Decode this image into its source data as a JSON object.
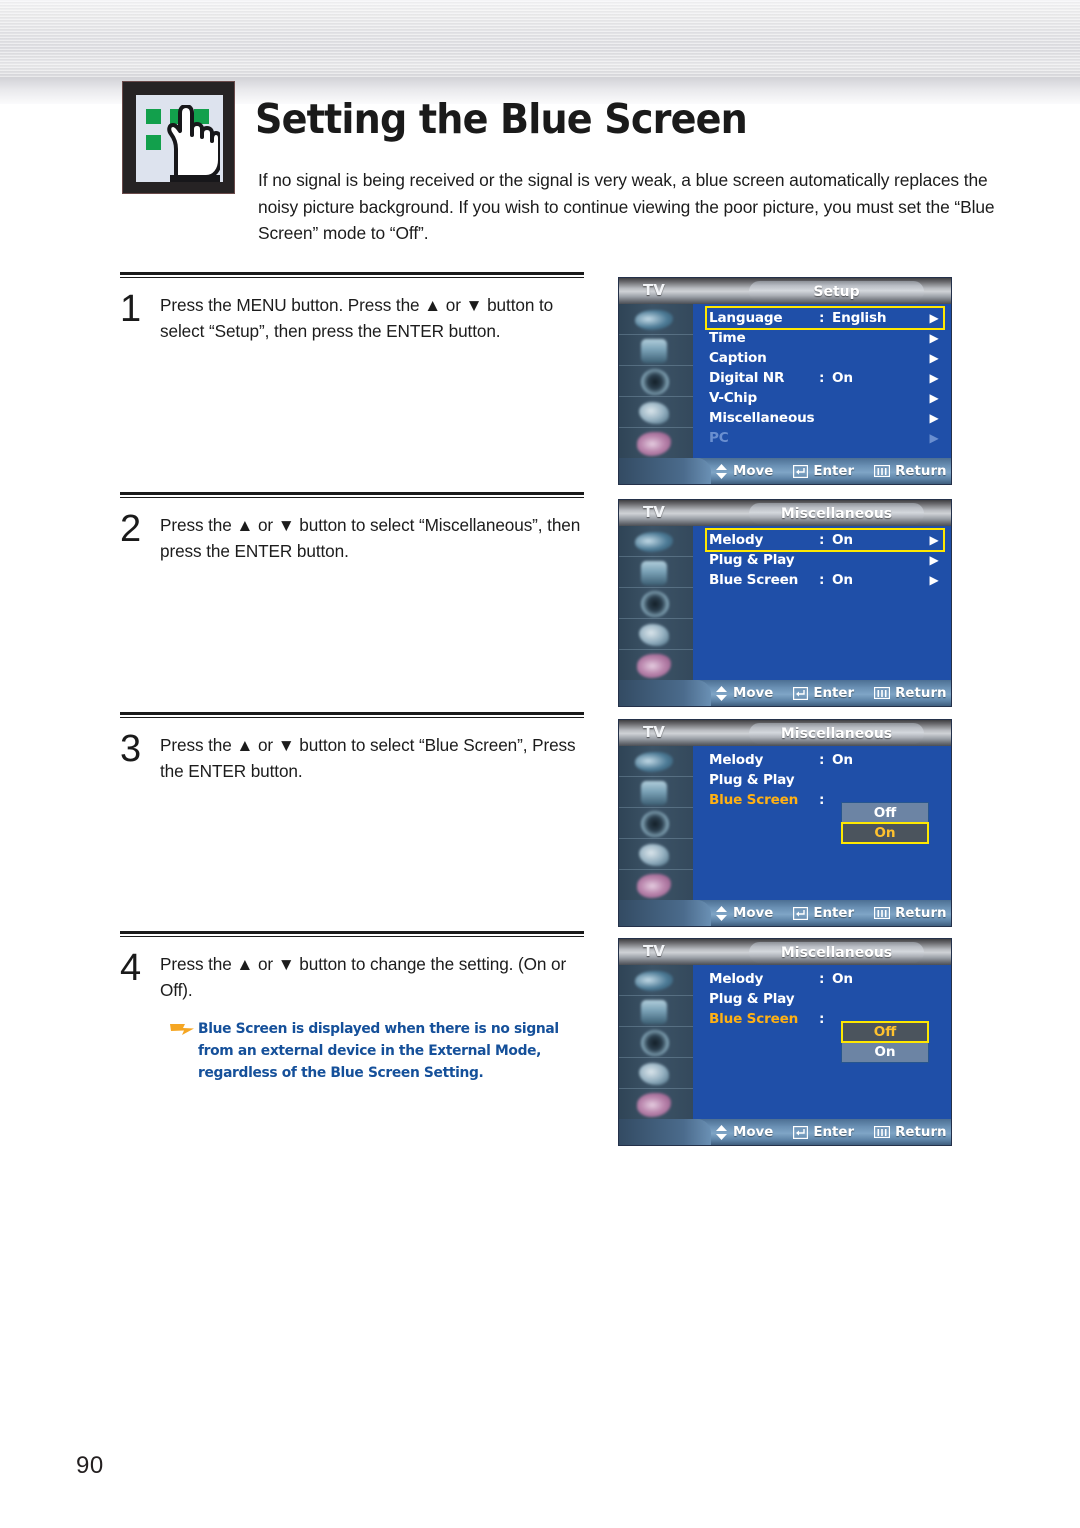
{
  "header": {
    "title": "Setting the Blue Screen",
    "icon": "hand-pointing-buttons-icon",
    "intro": "If no signal is being received or the signal is very weak, a blue screen automatically replaces the noisy picture background. If you wish to continue viewing the poor picture, you must set the “Blue Screen” mode to “Off”."
  },
  "steps": [
    {
      "number": "1",
      "text": "Press the MENU button. Press the ▲ or ▼ button to select “Setup”, then press the ENTER button."
    },
    {
      "number": "2",
      "text": "Press the ▲ or ▼ button to select “Miscellaneous”, then press the ENTER button."
    },
    {
      "number": "3",
      "text": "Press the ▲ or ▼ button to select “Blue Screen”, Press the ENTER button."
    },
    {
      "number": "4",
      "text": "Press the ▲ or ▼ button to change the setting. (On or Off)."
    }
  ],
  "note": {
    "bullet": "arrow-right-icon",
    "text": "Blue Screen is displayed when there is no signal from an external device in the External Mode, regardless of the Blue Screen Setting."
  },
  "page_number": "90",
  "osd_common": {
    "source_label": "TV",
    "bottom_bar": [
      {
        "icon": "updown-arrow-icon",
        "label": "Move"
      },
      {
        "icon": "enter-key-icon",
        "label": "Enter"
      },
      {
        "icon": "menu-bars-icon",
        "label": "Return"
      }
    ]
  },
  "colors": {
    "menu_blue": "#1f4fa8",
    "highlight_yellow": "#ffe800",
    "amber_text": "#ffb114",
    "note_blue": "#15509a",
    "icon_green": "#12a04c"
  },
  "osd_screens": [
    {
      "id": "setup-menu",
      "title": "Setup",
      "rows": [
        {
          "label": "Language",
          "colon": ":",
          "value": "English",
          "arrow": "▶",
          "state": "highlight"
        },
        {
          "label": "Time",
          "colon": "",
          "value": "",
          "arrow": "▶",
          "state": "normal"
        },
        {
          "label": "Caption",
          "colon": "",
          "value": "",
          "arrow": "▶",
          "state": "normal"
        },
        {
          "label": "Digital NR",
          "colon": ":",
          "value": "On",
          "arrow": "▶",
          "state": "normal"
        },
        {
          "label": "V-Chip",
          "colon": "",
          "value": "",
          "arrow": "▶",
          "state": "normal"
        },
        {
          "label": "Miscellaneous",
          "colon": "",
          "value": "",
          "arrow": "▶",
          "state": "normal"
        },
        {
          "label": "PC",
          "colon": "",
          "value": "",
          "arrow": "▶",
          "state": "dim"
        }
      ],
      "dropdown": null
    },
    {
      "id": "miscellaneous-menu",
      "title": "Miscellaneous",
      "rows": [
        {
          "label": "Melody",
          "colon": ":",
          "value": "On",
          "arrow": "▶",
          "state": "highlight"
        },
        {
          "label": "Plug & Play",
          "colon": "",
          "value": "",
          "arrow": "▶",
          "state": "normal"
        },
        {
          "label": "Blue Screen",
          "colon": ":",
          "value": "On",
          "arrow": "▶",
          "state": "normal"
        }
      ],
      "dropdown": null
    },
    {
      "id": "miscellaneous-menu-bluescreen-open-on",
      "title": "Miscellaneous",
      "rows": [
        {
          "label": "Melody",
          "colon": ":",
          "value": "On",
          "arrow": "",
          "state": "normal"
        },
        {
          "label": "Plug & Play",
          "colon": "",
          "value": "",
          "arrow": "",
          "state": "normal"
        },
        {
          "label": "Blue Screen",
          "colon": ":",
          "value": "",
          "arrow": "",
          "state": "amber"
        }
      ],
      "dropdown": {
        "options": [
          "Off",
          "On"
        ],
        "selected": "On"
      }
    },
    {
      "id": "miscellaneous-menu-bluescreen-open-off",
      "title": "Miscellaneous",
      "rows": [
        {
          "label": "Melody",
          "colon": ":",
          "value": "On",
          "arrow": "",
          "state": "normal"
        },
        {
          "label": "Plug & Play",
          "colon": "",
          "value": "",
          "arrow": "",
          "state": "normal"
        },
        {
          "label": "Blue Screen",
          "colon": ":",
          "value": "",
          "arrow": "",
          "state": "amber"
        }
      ],
      "dropdown": {
        "options": [
          "Off",
          "On"
        ],
        "selected": "Off"
      }
    }
  ]
}
